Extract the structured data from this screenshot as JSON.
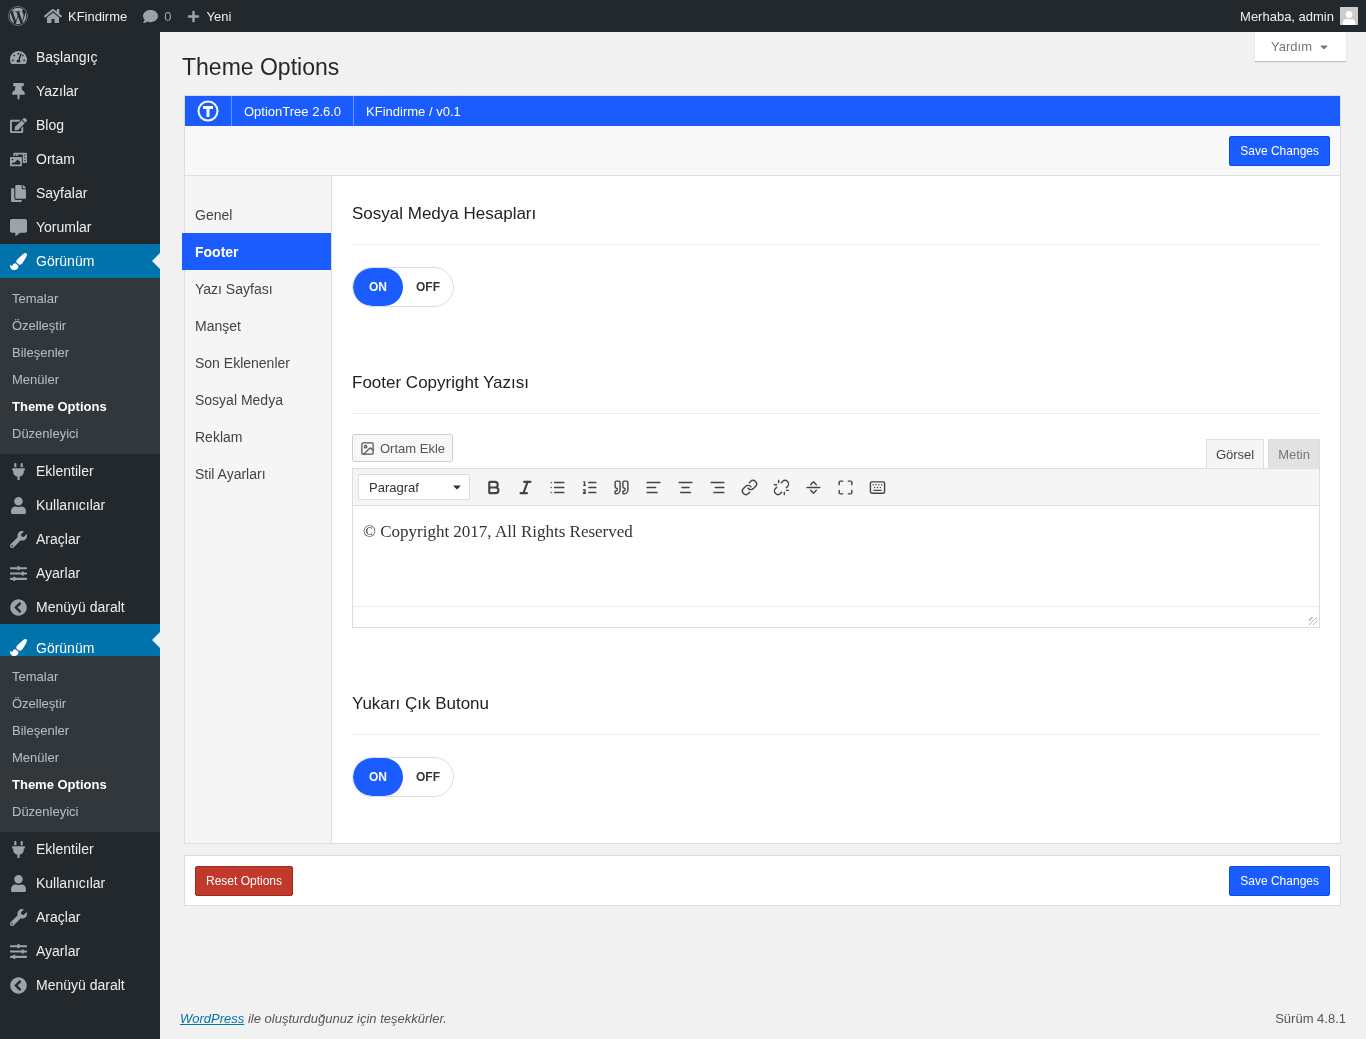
{
  "admin_bar": {
    "site_name": "KFindirme",
    "comments_count": "0",
    "new_label": "Yeni",
    "greeting": "Merhaba, admin"
  },
  "sidebar": [
    {
      "items": [
        {
          "label": "Başlangıç",
          "selected": false
        },
        {
          "label": "Yazılar",
          "selected": false
        },
        {
          "label": "Blog",
          "selected": false
        },
        {
          "label": "Ortam",
          "selected": false
        },
        {
          "label": "Sayfalar",
          "selected": false
        },
        {
          "label": "Yorumlar",
          "selected": false
        },
        {
          "label": "Görünüm",
          "selected": true,
          "children": [
            {
              "label": "Temalar",
              "selected": false
            },
            {
              "label": "Özelleştir",
              "selected": false
            },
            {
              "label": "Bileşenler",
              "selected": false
            },
            {
              "label": "Menüler",
              "selected": false
            },
            {
              "label": "Theme Options",
              "selected": true
            },
            {
              "label": "Düzenleyici",
              "selected": false
            }
          ]
        },
        {
          "label": "Eklentiler",
          "selected": false
        },
        {
          "label": "Kullanıcılar",
          "selected": false
        },
        {
          "label": "Araçlar",
          "selected": false
        },
        {
          "label": "Ayarlar",
          "selected": false
        },
        {
          "label": "Menüyü daralt",
          "selected": false
        }
      ]
    },
    {
      "items": [
        {
          "label": "Görünüm",
          "selected": true,
          "children": [
            {
              "label": "Temalar",
              "selected": false
            },
            {
              "label": "Özelleştir",
              "selected": false
            },
            {
              "label": "Bileşenler",
              "selected": false
            },
            {
              "label": "Menüler",
              "selected": false
            },
            {
              "label": "Theme Options",
              "selected": true
            },
            {
              "label": "Düzenleyici",
              "selected": false
            }
          ]
        },
        {
          "label": "Eklentiler",
          "selected": false
        },
        {
          "label": "Kullanıcılar",
          "selected": false
        },
        {
          "label": "Araçlar",
          "selected": false
        },
        {
          "label": "Ayarlar",
          "selected": false
        },
        {
          "label": "Menüyü daralt",
          "selected": false
        }
      ]
    }
  ],
  "page": {
    "title": "Theme Options",
    "help_label": "Yardım"
  },
  "header": {
    "version": "OptionTree 2.6.0",
    "theme": "KFindirme / v0.1"
  },
  "save_label": "Save Changes",
  "tabs": [
    {
      "label": "Genel",
      "selected": false
    },
    {
      "label": "Footer",
      "selected": true
    },
    {
      "label": "Yazı Sayfası",
      "selected": false
    },
    {
      "label": "Manşet",
      "selected": false
    },
    {
      "label": "Son Eklenenler",
      "selected": false
    },
    {
      "label": "Sosyal Medya",
      "selected": false
    },
    {
      "label": "Reklam",
      "selected": false
    },
    {
      "label": "Stil Ayarları",
      "selected": false
    }
  ],
  "settings": [
    {
      "kind": "toggle",
      "title": "Sosyal Medya Hesapları",
      "on_label": "ON",
      "off_label": "OFF",
      "on": true
    },
    {
      "kind": "editor",
      "title": "Footer Copyright Yazısı",
      "media_label": "Ortam Ekle",
      "modes": [
        {
          "label": "Görsel",
          "selected": true
        },
        {
          "label": "Metin",
          "selected": false
        }
      ],
      "format": "Paragraf",
      "content": "© Copyright 2017, All Rights Reserved"
    },
    {
      "kind": "toggle",
      "title": "Yukarı Çık Butonu",
      "on_label": "ON",
      "off_label": "OFF",
      "on": true
    }
  ],
  "bottom_bar": {
    "reset_label": "Reset Options",
    "save_label": "Save Changes"
  },
  "footer": {
    "link": "WordPress",
    "text": "ile oluşturduğunuz için teşekkürler.",
    "version": "Sürüm 4.8.1"
  }
}
